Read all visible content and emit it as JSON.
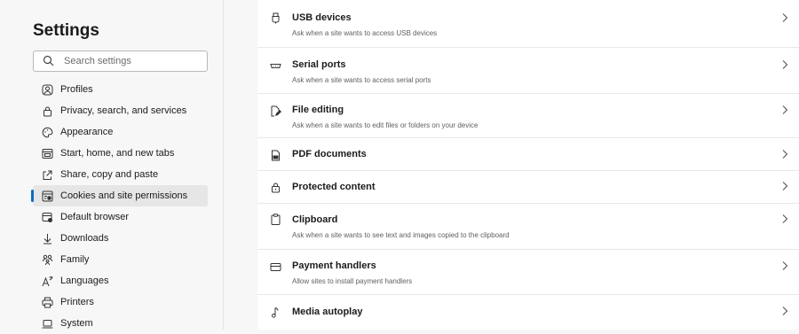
{
  "sidebar": {
    "title": "Settings",
    "search_placeholder": "Search settings",
    "items": [
      {
        "label": "Profiles"
      },
      {
        "label": "Privacy, search, and services"
      },
      {
        "label": "Appearance"
      },
      {
        "label": "Start, home, and new tabs"
      },
      {
        "label": "Share, copy and paste"
      },
      {
        "label": "Cookies and site permissions",
        "active": true
      },
      {
        "label": "Default browser"
      },
      {
        "label": "Downloads"
      },
      {
        "label": "Family"
      },
      {
        "label": "Languages"
      },
      {
        "label": "Printers"
      },
      {
        "label": "System"
      }
    ]
  },
  "permissions": [
    {
      "title": "USB devices",
      "description": "Ask when a site wants to access USB devices",
      "icon": "usb-icon"
    },
    {
      "title": "Serial ports",
      "description": "Ask when a site wants to access serial ports",
      "icon": "serial-port-icon"
    },
    {
      "title": "File editing",
      "description": "Ask when a site wants to edit files or folders on your device",
      "icon": "file-edit-icon"
    },
    {
      "title": "PDF documents",
      "description": "",
      "icon": "pdf-icon"
    },
    {
      "title": "Protected content",
      "description": "",
      "icon": "lock-icon"
    },
    {
      "title": "Clipboard",
      "description": "Ask when a site wants to see text and images copied to the clipboard",
      "icon": "clipboard-icon"
    },
    {
      "title": "Payment handlers",
      "description": "Allow sites to install payment handlers",
      "icon": "card-icon"
    },
    {
      "title": "Media autoplay",
      "description": "",
      "icon": "music-note-icon"
    }
  ],
  "colors": {
    "accent": "#0f6cbd",
    "sidebar_bg": "#f7f7f7",
    "panel_bg": "#ffffff"
  }
}
